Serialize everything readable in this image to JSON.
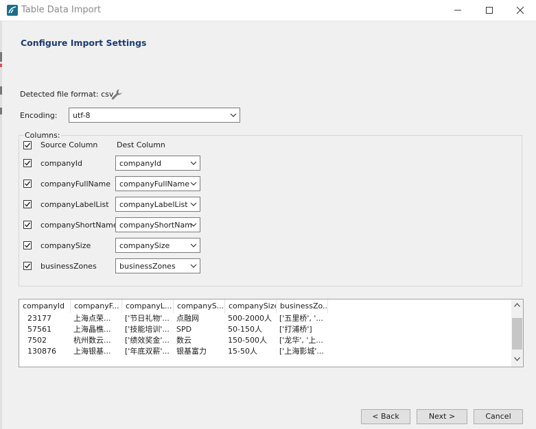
{
  "window": {
    "title": "Table Data Import"
  },
  "page": {
    "section_title": "Configure Import Settings",
    "detected_format": "Detected file format: csv",
    "encoding_label": "Encoding:",
    "encoding_value": "utf-8",
    "columns_legend": "Columns:",
    "header_source": "Source Column",
    "header_dest": "Dest Column"
  },
  "columns": [
    {
      "source": "companyId",
      "dest": "companyId",
      "checked": true
    },
    {
      "source": "companyFullName",
      "dest": "companyFullName",
      "checked": true
    },
    {
      "source": "companyLabelList",
      "dest": "companyLabelList",
      "checked": true
    },
    {
      "source": "companyShortName",
      "dest": "companyShortNam",
      "checked": true
    },
    {
      "source": "companySize",
      "dest": "companySize",
      "checked": true
    },
    {
      "source": "businessZones",
      "dest": "businessZones",
      "checked": true
    }
  ],
  "preview": {
    "headers": [
      "companyId",
      "companyF...",
      "companyL...",
      "companyS...",
      "companySize",
      "businessZo..."
    ],
    "rows": [
      [
        "23177",
        "上海点荣...",
        "['节日礼物'...",
        "点融网",
        "500-2000人",
        "['五里桥', '..."
      ],
      [
        "57561",
        "上海晶樵...",
        "['技能培训'...",
        "SPD",
        "50-150人",
        "['打浦桥']"
      ],
      [
        "7502",
        "杭州数云...",
        "['绩效奖金'...",
        "数云",
        "150-500人",
        "['龙华', '上..."
      ],
      [
        "130876",
        "上海银基...",
        "['年底双薪'...",
        "银基富力",
        "15-50人",
        "['上海影城'..."
      ]
    ]
  },
  "buttons": {
    "back": "< Back",
    "next": "Next >",
    "cancel": "Cancel"
  },
  "icons": {
    "app": "mysql-workbench-icon",
    "wrench": "wrench-icon"
  }
}
